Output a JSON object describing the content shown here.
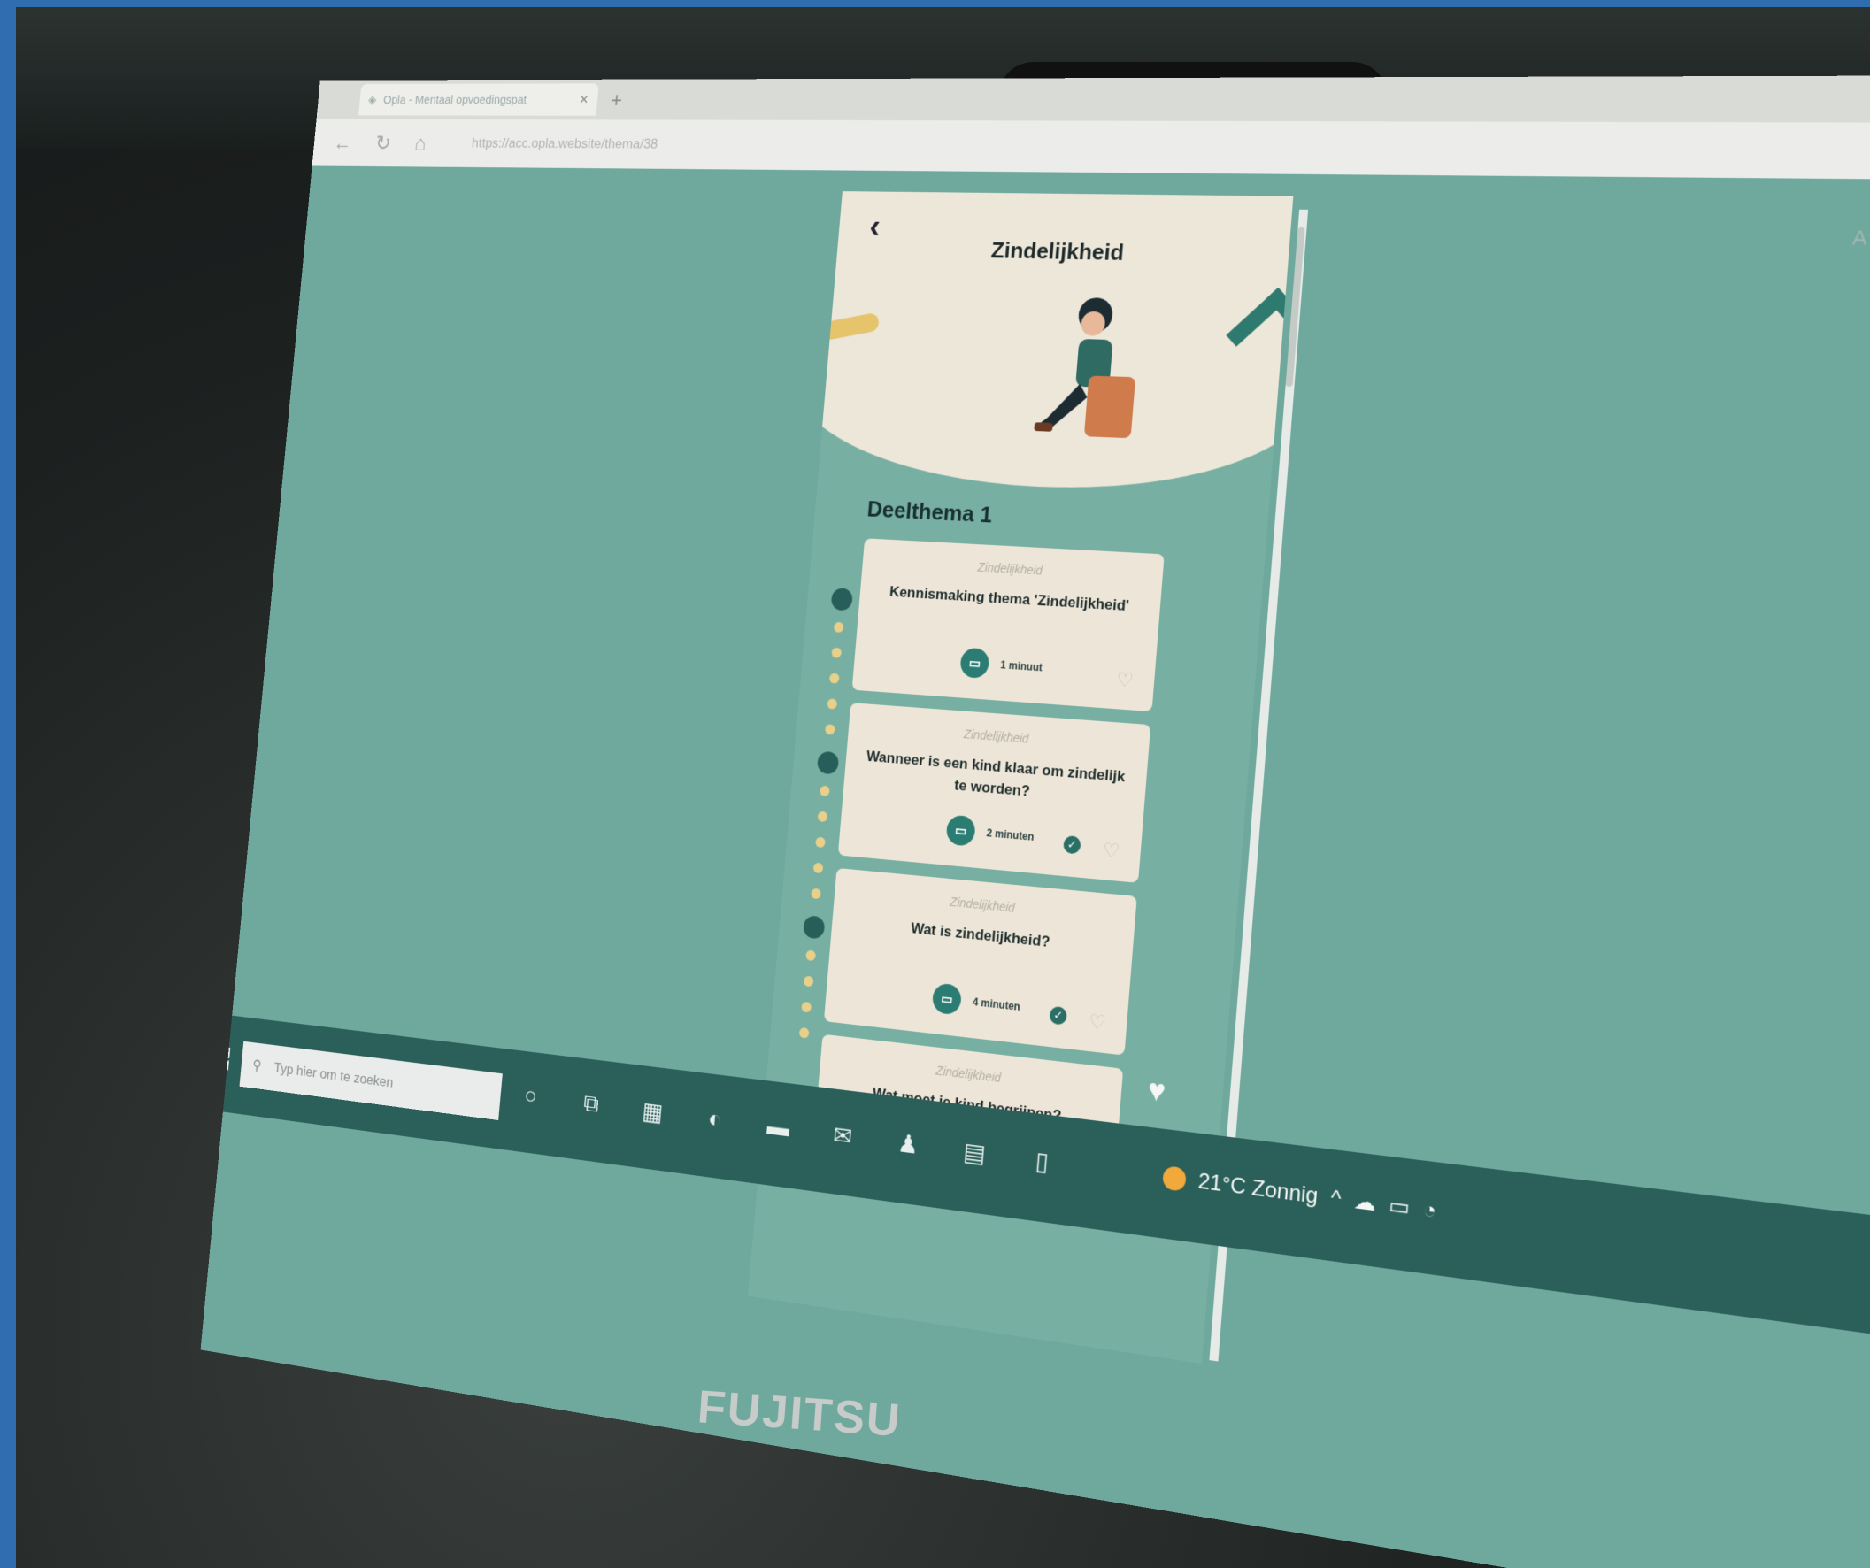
{
  "browser": {
    "tab_title": "Opla - Mentaal opvoedingspat",
    "url": "https://acc.opla.website/thema/38"
  },
  "app": {
    "title": "Zindelijkheid",
    "section_title": "Deelthema 1",
    "cards": [
      {
        "category": "Zindelijkheid",
        "title": "Kennismaking thema 'Zindelijkheid'",
        "duration": "1 minuut",
        "completed": false
      },
      {
        "category": "Zindelijkheid",
        "title": "Wanneer is een kind klaar om zindelijk te worden?",
        "duration": "2 minuten",
        "completed": true
      },
      {
        "category": "Zindelijkheid",
        "title": "Wat is zindelijkheid?",
        "duration": "4 minuten",
        "completed": true
      },
      {
        "category": "Zindelijkheid",
        "title": "Wat moet je kind begrijpen?",
        "duration": "",
        "completed": false
      }
    ]
  },
  "taskbar": {
    "search_placeholder": "Typ hier om te zoeken",
    "weather": "21°C Zonnig"
  },
  "device": {
    "brand": "FUJITSU"
  }
}
